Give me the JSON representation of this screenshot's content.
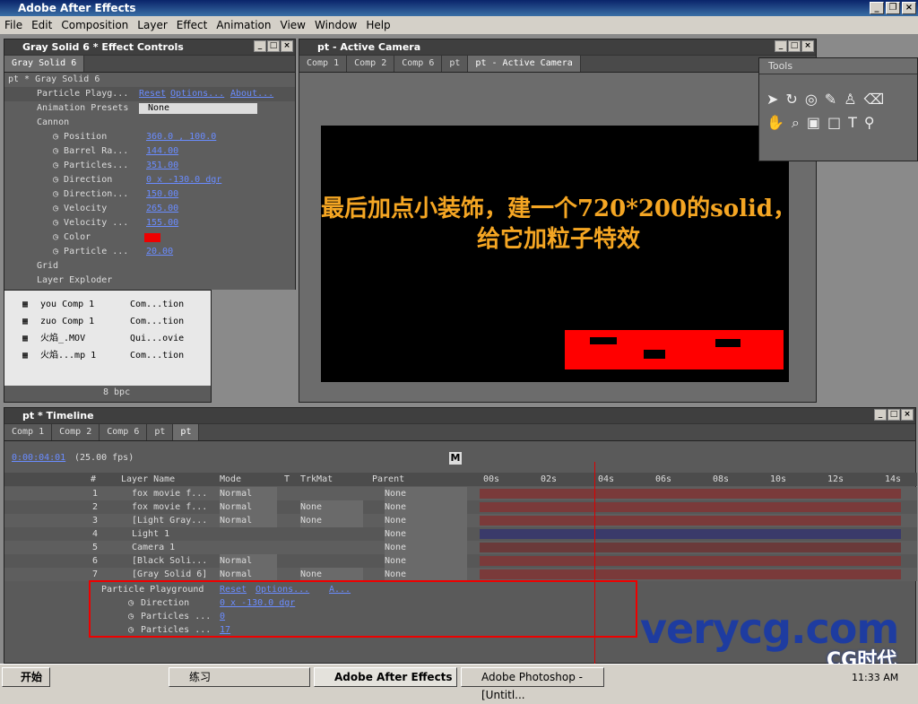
{
  "app": {
    "title": "Adobe After Effects"
  },
  "menu": [
    "File",
    "Edit",
    "Composition",
    "Layer",
    "Effect",
    "Animation",
    "View",
    "Window",
    "Help"
  ],
  "effect_controls": {
    "title": "Gray Solid 6 * Effect Controls",
    "tab": "Gray Solid 6",
    "path": "pt * Gray Solid 6",
    "effect_name": "Particle Playg...",
    "reset": "Reset",
    "options": "Options...",
    "about": "About...",
    "presets_label": "Animation Presets",
    "presets_value": "None",
    "cannon": "Cannon",
    "props": [
      {
        "name": "Position",
        "value": "360.0 , 100.0"
      },
      {
        "name": "Barrel Ra...",
        "value": "144.00"
      },
      {
        "name": "Particles...",
        "value": "351.00"
      },
      {
        "name": "Direction",
        "value": "0 x -130.0 dgr"
      },
      {
        "name": "Direction...",
        "value": "150.00"
      },
      {
        "name": "Velocity",
        "value": "265.00"
      },
      {
        "name": "Velocity ...",
        "value": "155.00"
      },
      {
        "name": "Color",
        "value": ""
      },
      {
        "name": "Particle ...",
        "value": "20.00"
      }
    ],
    "grid": "Grid",
    "layer_exploder": "Layer Exploder"
  },
  "project": {
    "items": [
      {
        "name": "you Comp 1",
        "type": "Com...tion"
      },
      {
        "name": "zuo Comp 1",
        "type": "Com...tion"
      },
      {
        "name": "火焰_.MOV",
        "type": "Qui...ovie"
      },
      {
        "name": "火焰...mp 1",
        "type": "Com...tion"
      }
    ],
    "bpc": "8 bpc"
  },
  "viewer": {
    "title": "pt - Active Camera",
    "tabs": [
      "Comp 1",
      "Comp 2",
      "Comp 6",
      "pt",
      "pt - Active Camera"
    ],
    "overlay_line1": "最后加点小装饰，建一个720*200的solid，",
    "overlay_line2": "给它加粒子特效"
  },
  "tools": {
    "title": "Tools"
  },
  "timeline": {
    "title": "pt * Timeline",
    "tabs": [
      "Comp 1",
      "Comp 2",
      "Comp 6",
      "pt",
      "pt"
    ],
    "timecode": "0:00:04:01",
    "fps": "(25.00 fps)",
    "m_label": "M",
    "headers": {
      "num": "#",
      "layer": "Layer Name",
      "mode": "Mode",
      "t": "T",
      "trkmat": "TrkMat",
      "parent": "Parent"
    },
    "ruler": [
      "00s",
      "02s",
      "04s",
      "06s",
      "08s",
      "10s",
      "12s",
      "14s"
    ],
    "layers": [
      {
        "num": "1",
        "name": "fox movie f...",
        "mode": "Normal",
        "trkmat": "",
        "parent": "None",
        "color": "#7a3a3a"
      },
      {
        "num": "2",
        "name": "fox movie f...",
        "mode": "Normal",
        "trkmat": "None",
        "parent": "None",
        "color": "#7a3a3a"
      },
      {
        "num": "3",
        "name": "[Light Gray...",
        "mode": "Normal",
        "trkmat": "None",
        "parent": "None",
        "color": "#7a3a3a"
      },
      {
        "num": "4",
        "name": "Light 1",
        "mode": "",
        "trkmat": "",
        "parent": "None",
        "color": "#3a3a6a"
      },
      {
        "num": "5",
        "name": "Camera 1",
        "mode": "",
        "trkmat": "",
        "parent": "None",
        "color": "#6a3a3a"
      },
      {
        "num": "6",
        "name": "[Black Soli...",
        "mode": "Normal",
        "trkmat": "",
        "parent": "None",
        "color": "#7a3a3a"
      },
      {
        "num": "7",
        "name": "[Gray Solid 6]",
        "mode": "Normal",
        "trkmat": "None",
        "parent": "None",
        "color": "#7a3a3a"
      }
    ],
    "effect_row": {
      "name": "Particle Playground",
      "reset": "Reset",
      "options": "Options...",
      "about": "A..."
    },
    "effect_props": [
      {
        "name": "Direction",
        "value": "0 x -130.0 dgr"
      },
      {
        "name": "Particles ...",
        "value": "0"
      },
      {
        "name": "Particles ...",
        "value": "17"
      }
    ]
  },
  "watermark": {
    "main": "verycg.com",
    "logo": "CG时代"
  },
  "taskbar": {
    "start": "开始",
    "items": [
      "练习",
      "Adobe After Effects",
      "Adobe Photoshop - [Untitl..."
    ],
    "clock": "11:33 AM"
  }
}
